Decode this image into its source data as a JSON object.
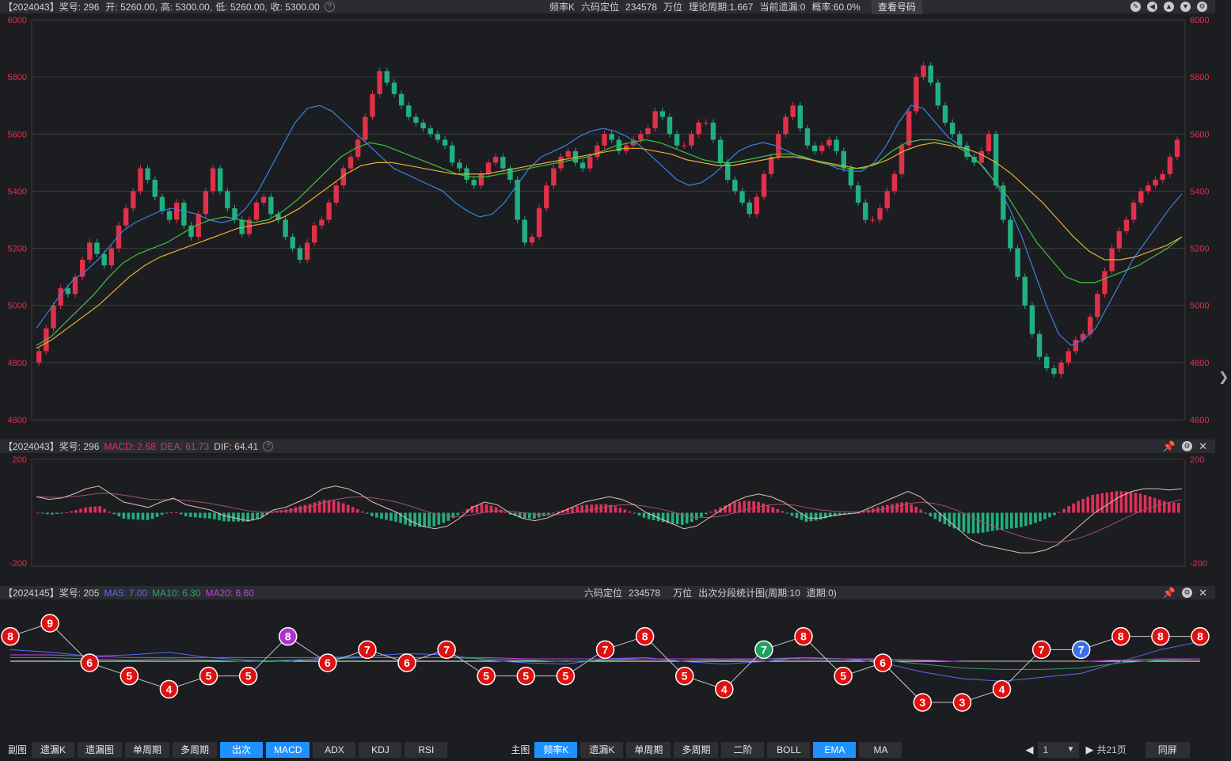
{
  "top": {
    "info": [
      "【2024043】奖号: 296",
      "开: 5260.00,",
      "高: 5300.00,",
      "低: 5260.00,",
      "收: 5300.00"
    ],
    "center": [
      "频率K",
      "六码定位",
      "234578",
      "万位",
      "理论周期:1.667",
      "当前遗漏:0",
      "概率:60.0%"
    ],
    "query_button": "查看号码",
    "y_ticks": [
      "6000",
      "5800",
      "5600",
      "5400",
      "5200",
      "5000",
      "4800",
      "4600"
    ]
  },
  "macd": {
    "label": "【2024043】奖号: 296",
    "macd": "MACD: 2.68",
    "dea": "DEA: 61.73",
    "dif": "DIF: 64.41",
    "y_top": "200",
    "y_bot": "-200",
    "colors": {
      "macd": "#e0305a",
      "dea": "#b05070",
      "dif": "#e0c0b0"
    }
  },
  "bottom": {
    "label": "【2024145】奖号: 205",
    "ma5": "MA5: 7.00",
    "ma10": "MA10: 6.30",
    "ma20": "MA20: 6.60",
    "center": [
      "六码定位",
      "234578",
      "万位",
      "出次分段统计图(周期:10",
      "遗期:0)"
    ],
    "colors": {
      "ma5": "#5a6af0",
      "ma10": "#30a070",
      "ma20": "#c040e0"
    }
  },
  "chart_data": [
    {
      "type": "candlestick",
      "ylim": [
        4600,
        6000
      ],
      "y_ticks": [
        6000,
        5800,
        5600,
        5400,
        5200,
        5000,
        4800,
        4600
      ],
      "close": [
        4840,
        4920,
        5000,
        5060,
        5040,
        5100,
        5160,
        5220,
        5180,
        5140,
        5200,
        5280,
        5340,
        5400,
        5480,
        5440,
        5380,
        5330,
        5300,
        5360,
        5280,
        5240,
        5320,
        5400,
        5480,
        5400,
        5340,
        5300,
        5250,
        5300,
        5360,
        5380,
        5320,
        5300,
        5240,
        5200,
        5160,
        5220,
        5280,
        5300,
        5360,
        5420,
        5480,
        5520,
        5580,
        5660,
        5740,
        5820,
        5780,
        5740,
        5700,
        5660,
        5640,
        5620,
        5600,
        5580,
        5560,
        5500,
        5480,
        5440,
        5420,
        5460,
        5500,
        5520,
        5480,
        5440,
        5300,
        5220,
        5240,
        5340,
        5420,
        5480,
        5520,
        5540,
        5500,
        5480,
        5520,
        5560,
        5600,
        5580,
        5540,
        5560,
        5580,
        5600,
        5620,
        5680,
        5660,
        5600,
        5560,
        5560,
        5600,
        5640,
        5640,
        5580,
        5500,
        5440,
        5400,
        5360,
        5320,
        5380,
        5460,
        5520,
        5600,
        5660,
        5700,
        5620,
        5560,
        5540,
        5560,
        5580,
        5540,
        5480,
        5420,
        5360,
        5300,
        5300,
        5340,
        5400,
        5460,
        5560,
        5680,
        5800,
        5840,
        5780,
        5700,
        5640,
        5600,
        5560,
        5520,
        5500,
        5540,
        5600,
        5420,
        5300,
        5200,
        5100,
        5000,
        4900,
        4820,
        4780,
        4760,
        4800,
        4840,
        4880,
        4900,
        4960,
        5040,
        5120,
        5200,
        5260,
        5300,
        5360,
        5400,
        5420,
        5440,
        5460,
        5520,
        5580
      ],
      "ema": [
        {
          "name": "",
          "color": "#3a82e0",
          "values": [
            4920,
            4980,
            5040,
            5090,
            5120,
            5160,
            5210,
            5260,
            5290,
            5310,
            5330,
            5340,
            5330,
            5320,
            5300,
            5290,
            5300,
            5340,
            5400,
            5480,
            5560,
            5640,
            5690,
            5700,
            5680,
            5640,
            5600,
            5560,
            5520,
            5480,
            5460,
            5440,
            5420,
            5400,
            5360,
            5330,
            5310,
            5320,
            5360,
            5420,
            5480,
            5520,
            5540,
            5560,
            5590,
            5610,
            5620,
            5610,
            5590,
            5560,
            5520,
            5480,
            5440,
            5420,
            5430,
            5460,
            5500,
            5540,
            5560,
            5570,
            5560,
            5540,
            5520,
            5510,
            5500,
            5480,
            5470,
            5470,
            5500,
            5560,
            5640,
            5700,
            5690,
            5640,
            5590,
            5560,
            5520,
            5480,
            5420,
            5340,
            5240,
            5120,
            5000,
            4900,
            4860,
            4880,
            4920,
            5000,
            5080,
            5160,
            5220,
            5280,
            5340,
            5390
          ]
        },
        {
          "name": "",
          "color": "#40c040",
          "values": [
            4860,
            4890,
            4940,
            4990,
            5040,
            5100,
            5150,
            5180,
            5200,
            5220,
            5250,
            5280,
            5300,
            5310,
            5300,
            5290,
            5300,
            5330,
            5370,
            5420,
            5470,
            5520,
            5550,
            5570,
            5560,
            5540,
            5520,
            5500,
            5480,
            5460,
            5450,
            5450,
            5460,
            5470,
            5480,
            5490,
            5500,
            5510,
            5520,
            5540,
            5560,
            5570,
            5580,
            5570,
            5550,
            5530,
            5510,
            5500,
            5500,
            5510,
            5520,
            5530,
            5530,
            5520,
            5500,
            5490,
            5480,
            5480,
            5500,
            5540,
            5570,
            5580,
            5580,
            5570,
            5540,
            5500,
            5440,
            5380,
            5300,
            5220,
            5160,
            5100,
            5080,
            5080,
            5100,
            5120,
            5140,
            5170,
            5200,
            5240
          ]
        },
        {
          "name": "",
          "color": "#e8b030",
          "values": [
            4850,
            4880,
            4920,
            4960,
            5000,
            5050,
            5100,
            5140,
            5170,
            5190,
            5210,
            5230,
            5250,
            5270,
            5280,
            5290,
            5310,
            5340,
            5380,
            5420,
            5460,
            5490,
            5500,
            5500,
            5490,
            5480,
            5470,
            5460,
            5460,
            5460,
            5470,
            5480,
            5490,
            5500,
            5510,
            5520,
            5530,
            5540,
            5550,
            5550,
            5540,
            5530,
            5510,
            5500,
            5490,
            5490,
            5500,
            5510,
            5520,
            5520,
            5510,
            5500,
            5490,
            5480,
            5490,
            5510,
            5540,
            5560,
            5570,
            5560,
            5550,
            5530,
            5500,
            5460,
            5410,
            5360,
            5300,
            5240,
            5190,
            5160,
            5160,
            5170,
            5190,
            5210,
            5240
          ]
        }
      ]
    },
    {
      "type": "bar",
      "ylim": [
        -200,
        200
      ],
      "series": [
        {
          "name": "DIF",
          "values": [
            60,
            50,
            55,
            70,
            90,
            100,
            70,
            40,
            30,
            20,
            40,
            55,
            30,
            20,
            10,
            -10,
            -20,
            -30,
            -20,
            10,
            20,
            40,
            60,
            90,
            100,
            90,
            70,
            40,
            20,
            0,
            -30,
            -50,
            -60,
            -50,
            -20,
            20,
            40,
            30,
            0,
            -20,
            -30,
            -20,
            0,
            20,
            40,
            50,
            60,
            50,
            30,
            0,
            -20,
            -40,
            -60,
            -50,
            -20,
            10,
            40,
            60,
            70,
            60,
            40,
            10,
            -20,
            -20,
            -10,
            -5,
            0,
            20,
            40,
            60,
            80,
            60,
            20,
            -20,
            -60,
            -100,
            -120,
            -130,
            -140,
            -150,
            -150,
            -140,
            -120,
            -80,
            -40,
            0,
            30,
            60,
            80,
            90,
            90,
            85,
            90
          ]
        }
      ]
    },
    {
      "type": "line",
      "categories": [
        "8",
        "9",
        "6",
        "5",
        "4",
        "5",
        "5",
        "8",
        "6",
        "7",
        "6",
        "7",
        "5",
        "5",
        "5",
        "7",
        "8",
        "5",
        "4",
        "7",
        "8",
        "5",
        "6",
        "3",
        "3",
        "4",
        "7",
        "7",
        "8",
        "8",
        "8"
      ],
      "values": [
        8,
        9,
        6,
        5,
        4,
        5,
        5,
        8,
        6,
        7,
        6,
        7,
        5,
        5,
        5,
        7,
        8,
        5,
        4,
        7,
        8,
        5,
        6,
        3,
        3,
        4,
        7,
        7,
        8,
        8,
        8
      ],
      "series": [
        {
          "name": "MA5",
          "values": [
            7.0,
            6.8,
            6.5,
            6.6,
            6.8,
            6.4,
            6.2,
            6.1,
            6.4,
            6.5,
            6.7,
            6.6,
            6.2,
            6.0,
            5.9,
            6.3,
            6.4,
            6.1,
            5.9,
            6.1,
            6.4,
            6.3,
            6.0,
            5.3,
            4.8,
            4.6,
            4.9,
            5.2,
            6.1,
            7.0,
            7.6
          ]
        },
        {
          "name": "MA10",
          "values": [
            6.4,
            6.4,
            6.3,
            6.2,
            6.3,
            6.2,
            6.1,
            6.2,
            6.3,
            6.4,
            6.4,
            6.4,
            6.3,
            6.2,
            6.1,
            6.2,
            6.3,
            6.3,
            6.2,
            6.3,
            6.4,
            6.3,
            6.2,
            5.9,
            5.6,
            5.5,
            5.5,
            5.6,
            6.0,
            6.2,
            6.3
          ]
        },
        {
          "name": "MA20",
          "values": [
            6.6,
            6.6,
            6.5,
            6.4,
            6.4,
            6.4,
            6.4,
            6.4,
            6.4,
            6.4,
            6.4,
            6.4,
            6.4,
            6.3,
            6.3,
            6.3,
            6.3,
            6.3,
            6.3,
            6.3,
            6.3,
            6.3,
            6.3,
            6.2,
            6.1,
            6.1,
            6.1,
            6.1,
            6.2,
            6.3,
            6.3
          ]
        }
      ],
      "special": {
        "7": "#b030d0",
        "19": "#20a060",
        "27": "#3a70f0"
      }
    }
  ],
  "toolbar": {
    "left_label": "副图",
    "left_buttons": [
      "遗漏K",
      "遗漏图",
      "单周期",
      "多周期",
      "出次",
      "MACD",
      "ADX",
      "KDJ",
      "RSI"
    ],
    "left_active": [
      4,
      5
    ],
    "mid_label": "主图",
    "mid_buttons": [
      "频率K",
      "遗漏K",
      "单周期",
      "多周期",
      "二阶",
      "BOLL",
      "EMA",
      "MA"
    ],
    "mid_active": [
      0,
      6
    ],
    "page_value": "1",
    "total_pages": "共21页",
    "sync": "同屏"
  }
}
